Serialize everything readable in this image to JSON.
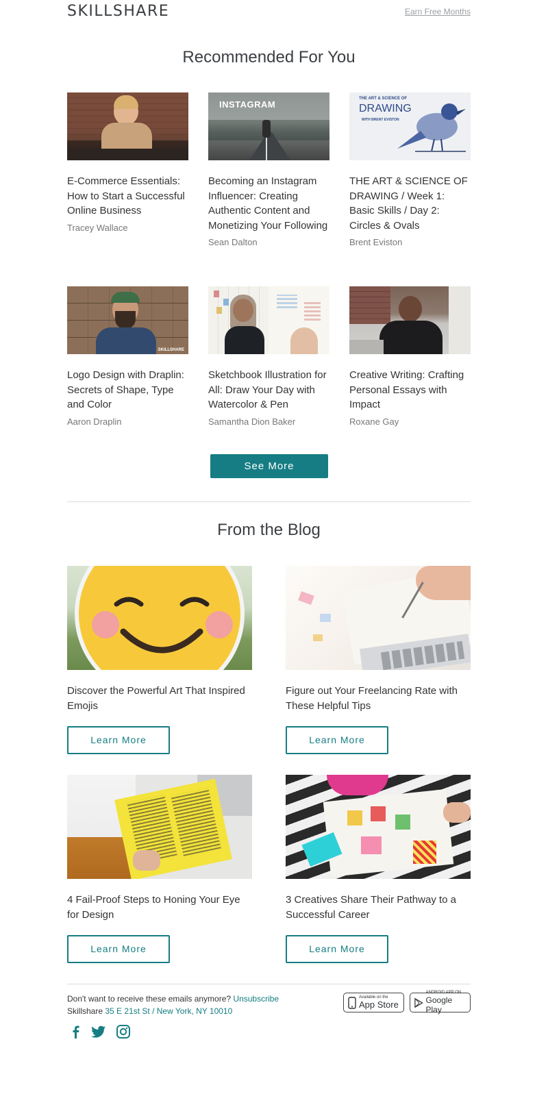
{
  "header": {
    "logo": "SKILLSHARE",
    "earn_link": "Earn Free Months"
  },
  "recommended": {
    "heading": "Recommended For You",
    "thumb_text": {
      "instagram": "INSTAGRAM",
      "drawing_top": "THE ART & SCIENCE OF",
      "drawing_main": "DRAWING",
      "drawing_sub": "WITH BRENT EVISTON",
      "skillshare_mark": "SKILLSHARE"
    },
    "courses": [
      {
        "title": "E-Commerce Essentials: How to Start a Successful Online Business",
        "author": "Tracey Wallace"
      },
      {
        "title": "Becoming an Instagram Influencer: Creating Authentic Content and Monetizing Your Following",
        "author": "Sean Dalton"
      },
      {
        "title": "THE ART & SCIENCE OF DRAWING / Week 1: Basic Skills / Day 2: Circles & Ovals",
        "author": "Brent Eviston"
      },
      {
        "title": "Logo Design with Draplin: Secrets of Shape, Type and Color",
        "author": "Aaron Draplin"
      },
      {
        "title": "Sketchbook Illustration for All: Draw Your Day with Watercolor & Pen",
        "author": "Samantha Dion Baker"
      },
      {
        "title": "Creative Writing: Crafting Personal Essays with Impact",
        "author": "Roxane Gay"
      }
    ],
    "see_more": "See More"
  },
  "blog": {
    "heading": "From the Blog",
    "posts": [
      {
        "title": "Discover the Powerful Art That Inspired Emojis",
        "cta": "Learn More"
      },
      {
        "title": "Figure out Your Freelancing Rate with These Helpful Tips",
        "cta": "Learn More"
      },
      {
        "title": "4 Fail-Proof Steps to Honing Your Eye for Design",
        "cta": "Learn More"
      },
      {
        "title": "3 Creatives Share Their Pathway to a Successful Career",
        "cta": "Learn More"
      }
    ]
  },
  "footer": {
    "unsub_text": "Don't want to receive these emails anymore?",
    "unsub_link": "Unsubscribe",
    "company": "Skillshare",
    "address": "35 E 21st St / New York, NY 10010",
    "app_store_small": "Available on the",
    "app_store_big": "App Store",
    "google_small": "ANDROID APP ON",
    "google_big": "Google Play"
  },
  "icons": [
    "facebook-icon",
    "twitter-icon",
    "instagram-icon",
    "apple-icon",
    "google-play-icon"
  ],
  "colors": {
    "accent": "#157d83",
    "text": "#333333",
    "muted": "#777777"
  }
}
